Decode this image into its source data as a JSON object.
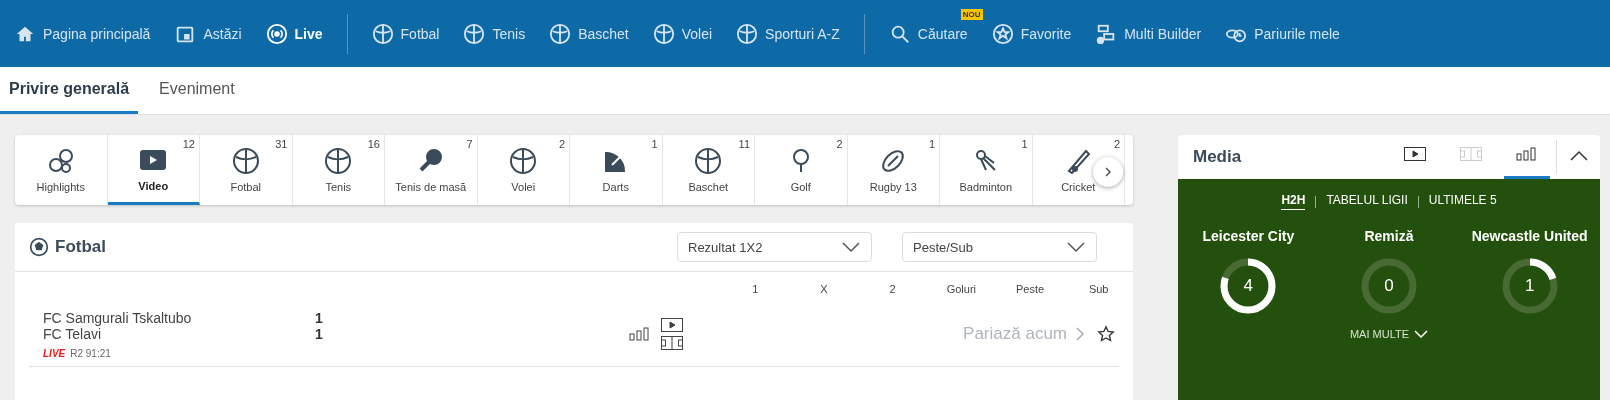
{
  "nav": {
    "groups": [
      [
        {
          "label": "Pagina principală",
          "selected": false
        },
        {
          "label": "Astăzi",
          "selected": false
        },
        {
          "label": "Live",
          "selected": true
        }
      ],
      [
        {
          "label": "Fotbal",
          "selected": false
        },
        {
          "label": "Tenis",
          "selected": false
        },
        {
          "label": "Baschet",
          "selected": false
        },
        {
          "label": "Volei",
          "selected": false
        },
        {
          "label": "Sporturi A-Z",
          "selected": false
        }
      ],
      [
        {
          "label": "Căutare",
          "selected": false,
          "badge": "NOU"
        },
        {
          "label": "Favorite",
          "selected": false
        },
        {
          "label": "Multi Builder",
          "selected": false
        },
        {
          "label": "Pariurile mele",
          "selected": false
        }
      ]
    ]
  },
  "subtabs": [
    {
      "label": "Privire generală",
      "selected": true
    },
    {
      "label": "Eveniment",
      "selected": false
    }
  ],
  "sports": [
    {
      "label": "Highlights",
      "selected": false
    },
    {
      "label": "Video",
      "count": "12",
      "selected": true
    },
    {
      "label": "Fotbal",
      "count": "31",
      "selected": false
    },
    {
      "label": "Tenis",
      "count": "16",
      "selected": false
    },
    {
      "label": "Tenis de masă",
      "count": "7",
      "selected": false
    },
    {
      "label": "Volei",
      "count": "2",
      "selected": false
    },
    {
      "label": "Darts",
      "count": "1",
      "selected": false
    },
    {
      "label": "Baschet",
      "count": "11",
      "selected": false
    },
    {
      "label": "Golf",
      "count": "2",
      "selected": false
    },
    {
      "label": "Rugby 13",
      "count": "1",
      "selected": false
    },
    {
      "label": "Badminton",
      "count": "1",
      "selected": false
    },
    {
      "label": "Cricket",
      "count": "2",
      "selected": false
    }
  ],
  "football": {
    "title": "Fotbal",
    "dropdowns": [
      "Rezultat 1X2",
      "Peste/Sub"
    ],
    "columns": [
      "1",
      "X",
      "2",
      "Goluri",
      "Peste",
      "Sub"
    ],
    "match": {
      "teams": [
        {
          "name": "FC Samgurali Tskaltubo",
          "score": "1"
        },
        {
          "name": "FC Telavi",
          "score": "1"
        }
      ],
      "live": "LIVE",
      "period": "R2 91:21",
      "action": "Pariază acum"
    }
  },
  "media": {
    "title": "Media",
    "views": [
      {
        "selected": false,
        "disabled": false
      },
      {
        "selected": false,
        "disabled": true
      },
      {
        "selected": true,
        "disabled": false
      }
    ],
    "tabs": [
      {
        "label": "H2H",
        "selected": true
      },
      {
        "label": "TABELUL LIGII",
        "selected": false
      },
      {
        "label": "ULTIMELE 5",
        "selected": false
      }
    ],
    "stats": [
      {
        "name": "Leicester City",
        "value": "4",
        "level": 0.8
      },
      {
        "name": "Remiză",
        "value": "0",
        "level": 0
      },
      {
        "name": "Newcastle United",
        "value": "1",
        "level": 0.2
      }
    ],
    "more": "MAI MULTE"
  }
}
